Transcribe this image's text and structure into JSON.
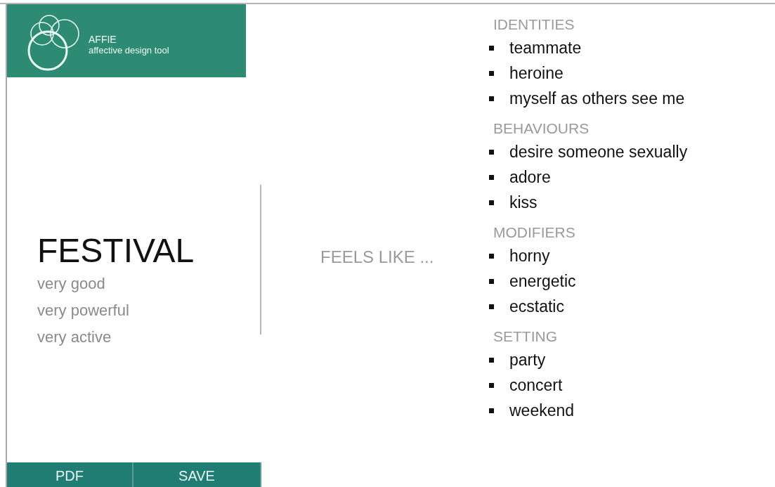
{
  "app": {
    "name": "AFFIE",
    "tagline": "affective design tool"
  },
  "event": {
    "title": "FESTIVAL",
    "ratings": [
      "very good",
      "very powerful",
      "very active"
    ]
  },
  "buttons": [
    "PDF",
    "SAVE"
  ],
  "connector": "FEELS LIKE ...",
  "sections": [
    {
      "heading": "IDENTITIES",
      "items": [
        "teammate",
        "heroine",
        "myself as others see me"
      ]
    },
    {
      "heading": "BEHAVIOURS",
      "items": [
        "desire someone sexually",
        "adore",
        "kiss"
      ]
    },
    {
      "heading": "MODIFIERS",
      "items": [
        "horny",
        "energetic",
        "ecstatic"
      ]
    },
    {
      "heading": "SETTING",
      "items": [
        "party",
        "concert",
        "weekend"
      ]
    }
  ]
}
